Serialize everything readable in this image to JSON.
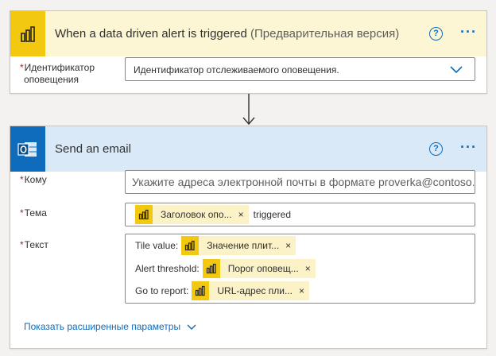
{
  "trigger": {
    "title": "When a data driven alert is triggered",
    "title_suffix": "(Предварительная версия)",
    "icon": "power-bi-icon",
    "field": {
      "label_line1": "Идентификатор",
      "label_line2": "оповещения",
      "required_mark": "*",
      "value": "Идентификатор отслеживаемого оповещения."
    },
    "help": "?",
    "more": "···"
  },
  "action": {
    "title": "Send an email",
    "icon": "outlook-icon",
    "help": "?",
    "more": "···",
    "to": {
      "label": "Кому",
      "required_mark": "*",
      "placeholder": "Укажите адреса электронной почты в формате proverka@contoso.com"
    },
    "subject": {
      "label": "Тема",
      "required_mark": "*",
      "token_label": "Заголовок опо...",
      "token_close": "×",
      "trailing_text": "triggered"
    },
    "body": {
      "label": "Текст",
      "required_mark": "*",
      "lines": [
        {
          "prefix": "Tile value:",
          "token_label": "Значение плит...",
          "token_close": "×"
        },
        {
          "prefix": "Alert threshold:",
          "token_label": "Порог оповещ...",
          "token_close": "×"
        },
        {
          "prefix": "Go to report:",
          "token_label": "URL-адрес пли...",
          "token_close": "×"
        }
      ]
    },
    "advanced_link": "Показать расширенные параметры"
  },
  "colors": {
    "accent": "#0f6cbd",
    "power_bi": "#f2c811",
    "trigger_header": "#fcf6d4",
    "action_header": "#d9e9f8",
    "required": "#a4262c"
  }
}
